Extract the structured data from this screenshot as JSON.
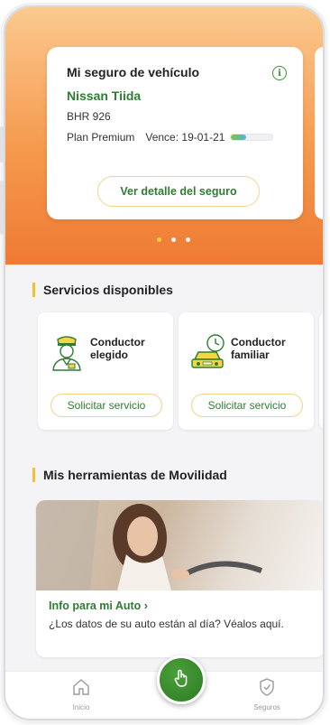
{
  "vehicle_card": {
    "title": "Mi seguro de vehículo",
    "car_name": "Nissan Tiida",
    "plate": "BHR 926",
    "plan": "Plan Premium",
    "expiry": "Vence: 19-01-21",
    "validity_progress": 0.35,
    "detail_button": "Ver detalle del seguro"
  },
  "carousel": {
    "page_count": 3,
    "active_index": 0
  },
  "services": {
    "title": "Servicios disponibles",
    "items": [
      {
        "label_line1": "Conductor",
        "label_line2": "elegido",
        "button": "Solicitar servicio",
        "icon": "chauffeur-icon"
      },
      {
        "label_line1": "Conductor",
        "label_line2": "familiar",
        "button": "Solicitar servicio",
        "icon": "family-car-icon"
      }
    ]
  },
  "tools": {
    "title": "Mis herramientas de Movilidad",
    "link": "Info para mi Auto  ›",
    "description": "¿Los datos de su auto están al día? Véalos aquí."
  },
  "bottom_nav": {
    "home_label": "Inicio",
    "insurance_label": "Seguros"
  },
  "colors": {
    "brand_green": "#2e7d32",
    "accent_yellow": "#f1c232",
    "hero_orange": "#f59a4e"
  }
}
